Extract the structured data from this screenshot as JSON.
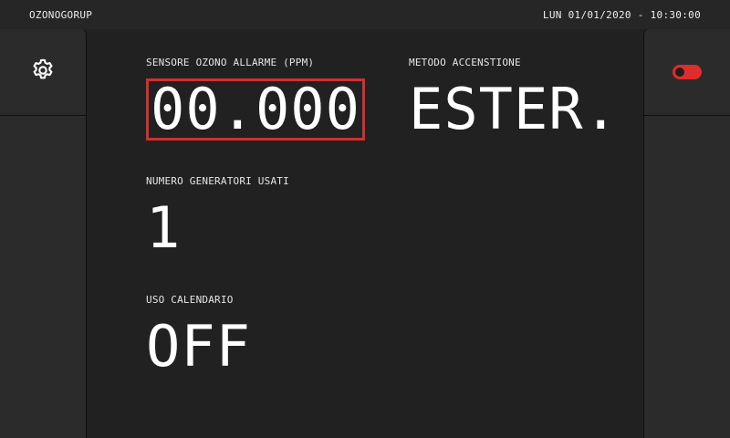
{
  "header": {
    "brand": "OZONOGORUP",
    "datetime": "LUN 01/01/2020 - 10:30:00"
  },
  "sidebar_left": {
    "settings_icon": "gear-icon"
  },
  "sidebar_right": {
    "toggle_icon": "toggle-icon",
    "toggle_state": "off",
    "toggle_color": "#e02c2c"
  },
  "fields": {
    "ozone_alarm": {
      "label": "SENSORE OZONO ALLARME (PPM)",
      "value": "00.000"
    },
    "start_method": {
      "label": "METODO ACCENSTIONE",
      "value": "ESTER."
    },
    "generators": {
      "label": "NUMERO GENERATORI USATI",
      "value": "1"
    },
    "calendar": {
      "label": "USO CALENDARIO",
      "value": "OFF"
    }
  },
  "colors": {
    "background": "#212121",
    "panel": "#2b2b2b",
    "highlight_border": "#d32f2f",
    "text": "#ffffff"
  }
}
